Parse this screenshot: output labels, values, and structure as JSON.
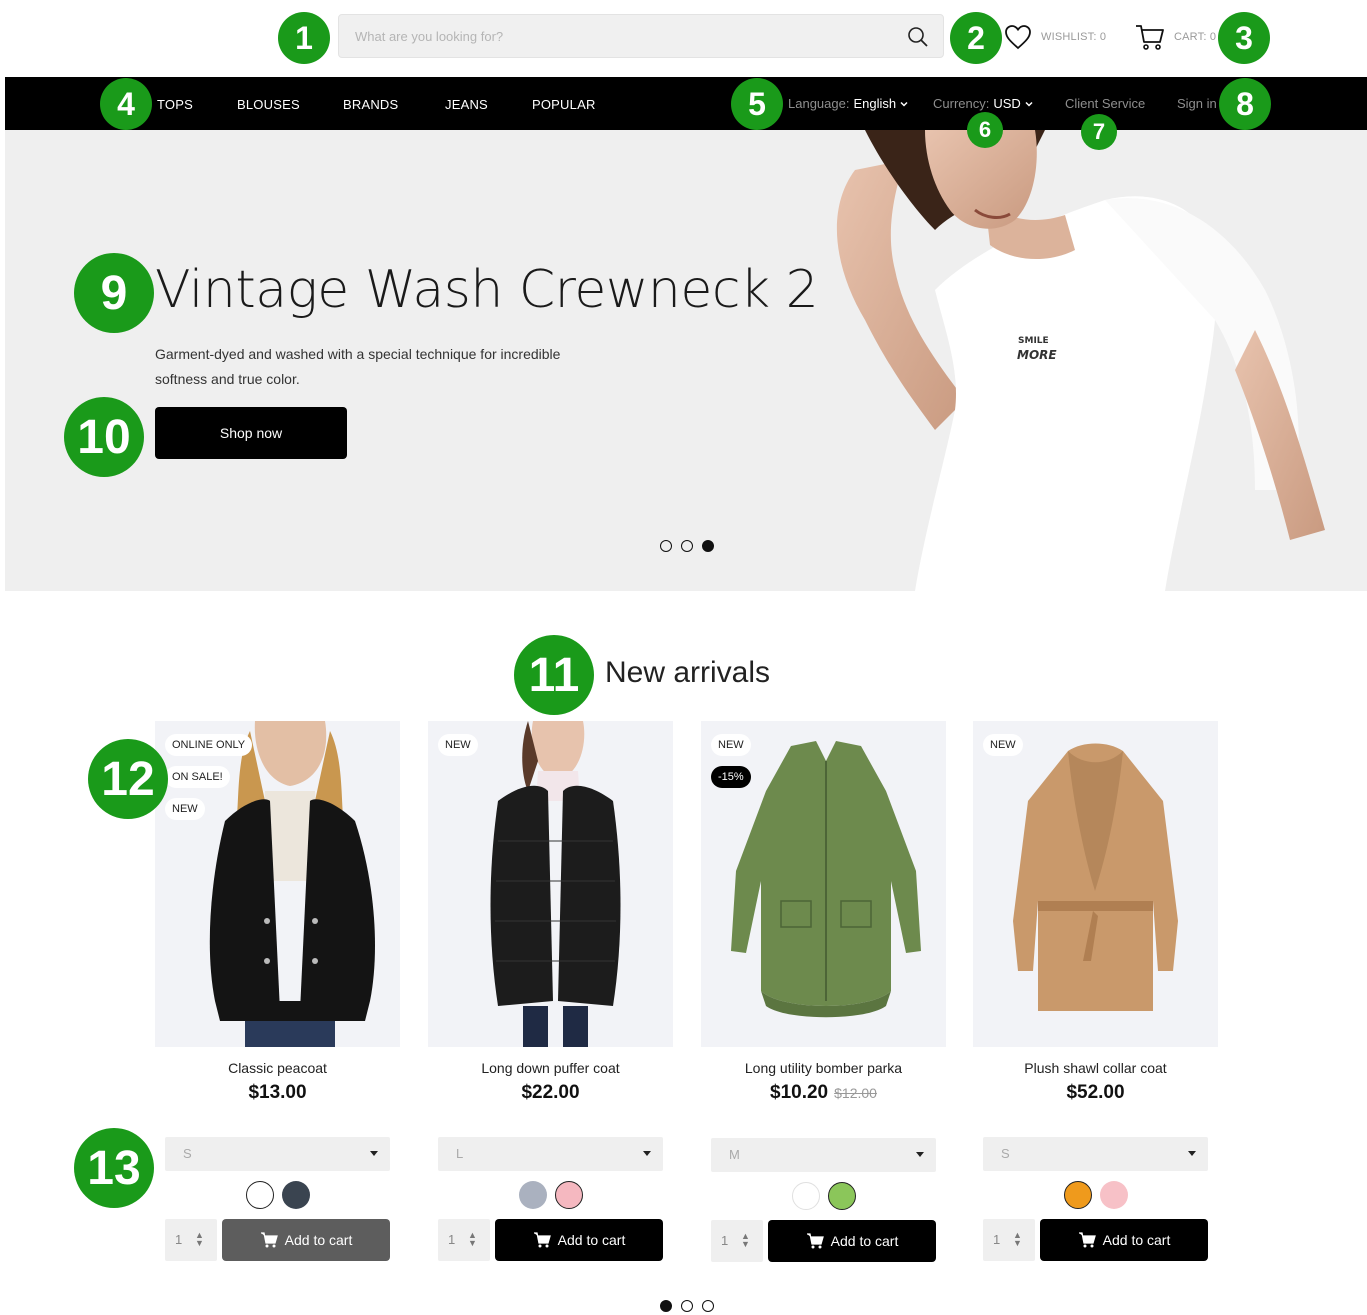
{
  "header": {
    "search_placeholder": "What are you looking for?",
    "wishlist_label": "WISHLIST: 0",
    "cart_label": "CART: 0"
  },
  "nav": {
    "items": [
      "TOPS",
      "BLOUSES",
      "BRANDS",
      "JEANS",
      "POPULAR"
    ],
    "language_label": "Language:",
    "language_value": "English",
    "currency_label": "Currency:",
    "currency_value": "USD",
    "client_service": "Client Service",
    "sign_in": "Sign in"
  },
  "hero": {
    "title": "Vintage Wash Crewneck 2",
    "description": "Garment-dyed and washed with a special technique for incredible softness and true color.",
    "button": "Shop now",
    "tshirt_print_1": "SMILE",
    "tshirt_print_2": "MORE",
    "active_slide": 3,
    "slide_count": 3
  },
  "section": {
    "title": "New arrivals"
  },
  "products": [
    {
      "name": "Classic peacoat",
      "price": "$13.00",
      "old_price": "",
      "badges": [
        "ONLINE ONLY",
        "ON SALE!",
        "NEW"
      ],
      "size": "S",
      "qty": "1",
      "swatches": [
        "#ffffff",
        "#3a4450"
      ],
      "add_label": "Add to cart",
      "button_color": "#5d5d5d"
    },
    {
      "name": "Long down puffer coat",
      "price": "$22.00",
      "old_price": "",
      "badges": [
        "NEW"
      ],
      "size": "L",
      "qty": "1",
      "swatches": [
        "#aab1bf",
        "#f5b8c0"
      ],
      "add_label": "Add to cart",
      "button_color": "#000000"
    },
    {
      "name": "Long utility bomber parka",
      "price": "$10.20",
      "old_price": "$12.00",
      "badges": [
        "NEW",
        "-15%"
      ],
      "size": "M",
      "qty": "1",
      "swatches": [
        "#ffffff",
        "#8bc65a"
      ],
      "add_label": "Add to cart",
      "button_color": "#000000"
    },
    {
      "name": "Plush shawl collar coat",
      "price": "$52.00",
      "old_price": "",
      "badges": [
        "NEW"
      ],
      "size": "S",
      "qty": "1",
      "swatches": [
        "#ef9a1c",
        "#f7c1c7"
      ],
      "add_label": "Add to cart",
      "button_color": "#000000"
    }
  ],
  "carousel": {
    "active_page": 1,
    "page_count": 3
  },
  "markers": [
    "1",
    "2",
    "3",
    "4",
    "5",
    "6",
    "7",
    "8",
    "9",
    "10",
    "11",
    "12",
    "13"
  ],
  "colors": {
    "accent": "#1a9a1a",
    "nav_bg": "#000000",
    "hero_bg": "#efefef"
  }
}
